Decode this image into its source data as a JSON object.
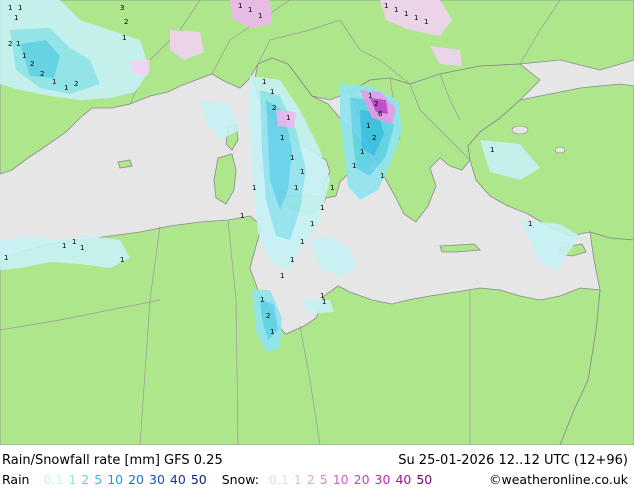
{
  "title": "Rain/Snowfall rate [mm] GFS 0.25",
  "run_info": "Su 25-01-2026 12..12 UTC (12+96)",
  "legend": {
    "rain_label": "Rain",
    "rain_scale": [
      {
        "value": "0.1",
        "color": "#c6f2f5"
      },
      {
        "value": "1",
        "color": "#8fe4f0"
      },
      {
        "value": "2",
        "color": "#5fd2ec"
      },
      {
        "value": "5",
        "color": "#35bde6"
      },
      {
        "value": "10",
        "color": "#1e9be0"
      },
      {
        "value": "20",
        "color": "#1d6fd0"
      },
      {
        "value": "30",
        "color": "#1a4fb8"
      },
      {
        "value": "40",
        "color": "#16349a"
      },
      {
        "value": "50",
        "color": "#101f7c"
      }
    ],
    "snow_label": "Snow:",
    "snow_scale": [
      {
        "value": "0.1",
        "color": "#f3d3f3"
      },
      {
        "value": "1",
        "color": "#eeb7ee"
      },
      {
        "value": "2",
        "color": "#e79be6"
      },
      {
        "value": "5",
        "color": "#de7fde"
      },
      {
        "value": "10",
        "color": "#d45fd4"
      },
      {
        "value": "20",
        "color": "#c642c6"
      },
      {
        "value": "30",
        "color": "#b22ab2"
      },
      {
        "value": "40",
        "color": "#961696"
      },
      {
        "value": "50",
        "color": "#760876"
      }
    ]
  },
  "credit": "©weatheronline.co.uk",
  "colors": {
    "land": "#aee68c",
    "sea": "#e6e6e6",
    "border": "#999999",
    "coast": "#8a8a8a"
  }
}
